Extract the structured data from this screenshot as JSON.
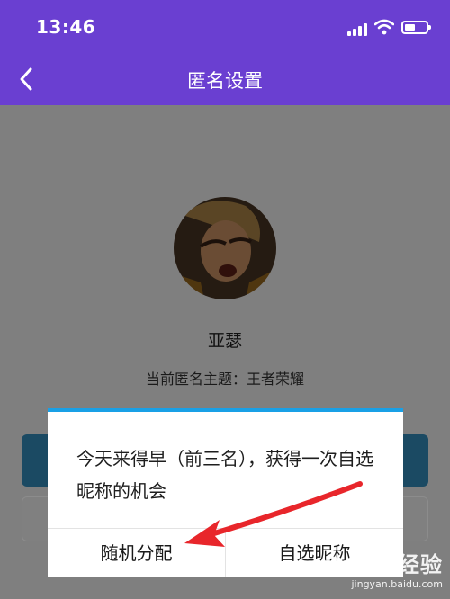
{
  "status_bar": {
    "time": "13:46"
  },
  "nav": {
    "title": "匿名设置"
  },
  "profile": {
    "name": "亚瑟",
    "theme_text": "当前匿名主题：王者荣耀"
  },
  "dialog": {
    "message": "今天来得早（前三名），获得一次自选昵称的机会",
    "random_label": "随机分配",
    "custom_label": "自选昵称"
  },
  "colors": {
    "nav_bg": "#6a3fd1",
    "dialog_accent": "#19a0e6",
    "annotation_arrow": "#e8262b"
  },
  "watermark": {
    "brand": "Baidu经验",
    "url": "jingyan.baidu.com"
  }
}
